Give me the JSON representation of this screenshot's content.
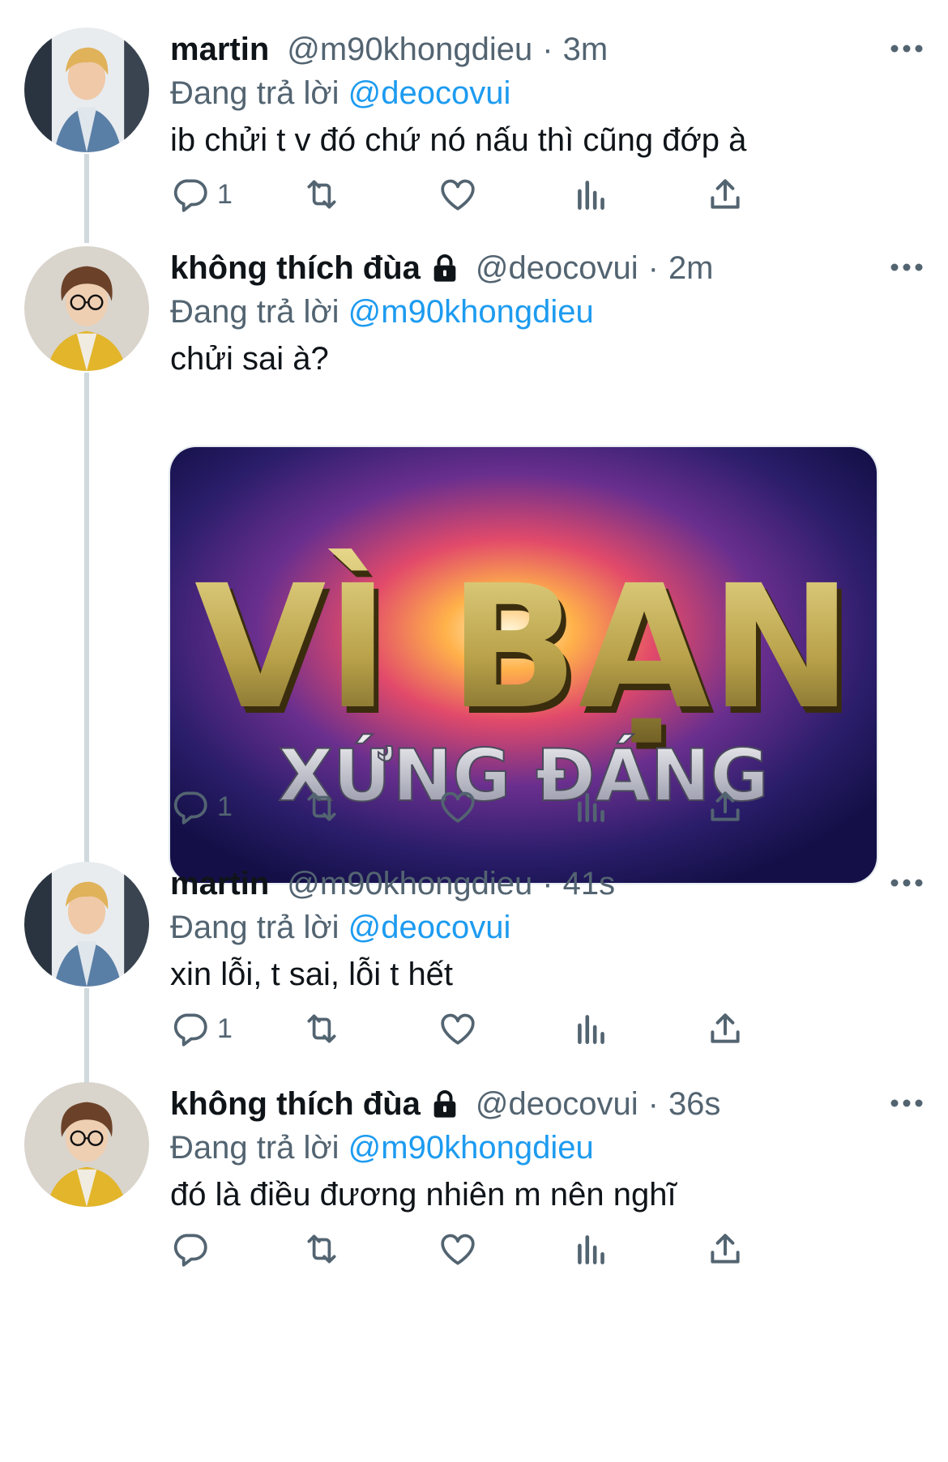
{
  "colors": {
    "text_primary": "#0f1419",
    "text_secondary": "#536471",
    "link": "#1d9bf0",
    "thread_line": "#cfd9de"
  },
  "icons": {
    "reply": "speech-bubble-icon",
    "retweet": "retweet-arrows-icon",
    "like": "heart-icon",
    "views": "bar-chart-icon",
    "share": "share-upload-icon",
    "more": "three-dots-icon",
    "lock": "lock-icon"
  },
  "tweets": [
    {
      "display_name": "martin",
      "handle": "@m90khongdieu",
      "separator": "·",
      "time": "3m",
      "reply_prefix": "Đang trả lời",
      "reply_to": "@deocovui",
      "text": "ib chửi t v đó chứ nó nấu thì cũng đớp à",
      "reply_count": "1",
      "protected": false
    },
    {
      "display_name": "không thích đùa",
      "handle": "@deocovui",
      "separator": "·",
      "time": "2m",
      "reply_prefix": "Đang trả lời",
      "reply_to": "@m90khongdieu",
      "text": "chửi sai à?",
      "reply_count": "1",
      "protected": true,
      "media": {
        "line1": "VÌ BẠN",
        "line2": "XỨNG ĐÁNG"
      }
    },
    {
      "display_name": "martin",
      "handle": "@m90khongdieu",
      "separator": "·",
      "time": "41s",
      "reply_prefix": "Đang trả lời",
      "reply_to": "@deocovui",
      "text": "xin lỗi, t sai, lỗi t hết",
      "reply_count": "1",
      "protected": false
    },
    {
      "display_name": "không thích đùa",
      "handle": "@deocovui",
      "separator": "·",
      "time": "36s",
      "reply_prefix": "Đang trả lời",
      "reply_to": "@m90khongdieu",
      "text": "đó là điều đương nhiên m nên nghĩ",
      "reply_count": "",
      "protected": true
    }
  ]
}
